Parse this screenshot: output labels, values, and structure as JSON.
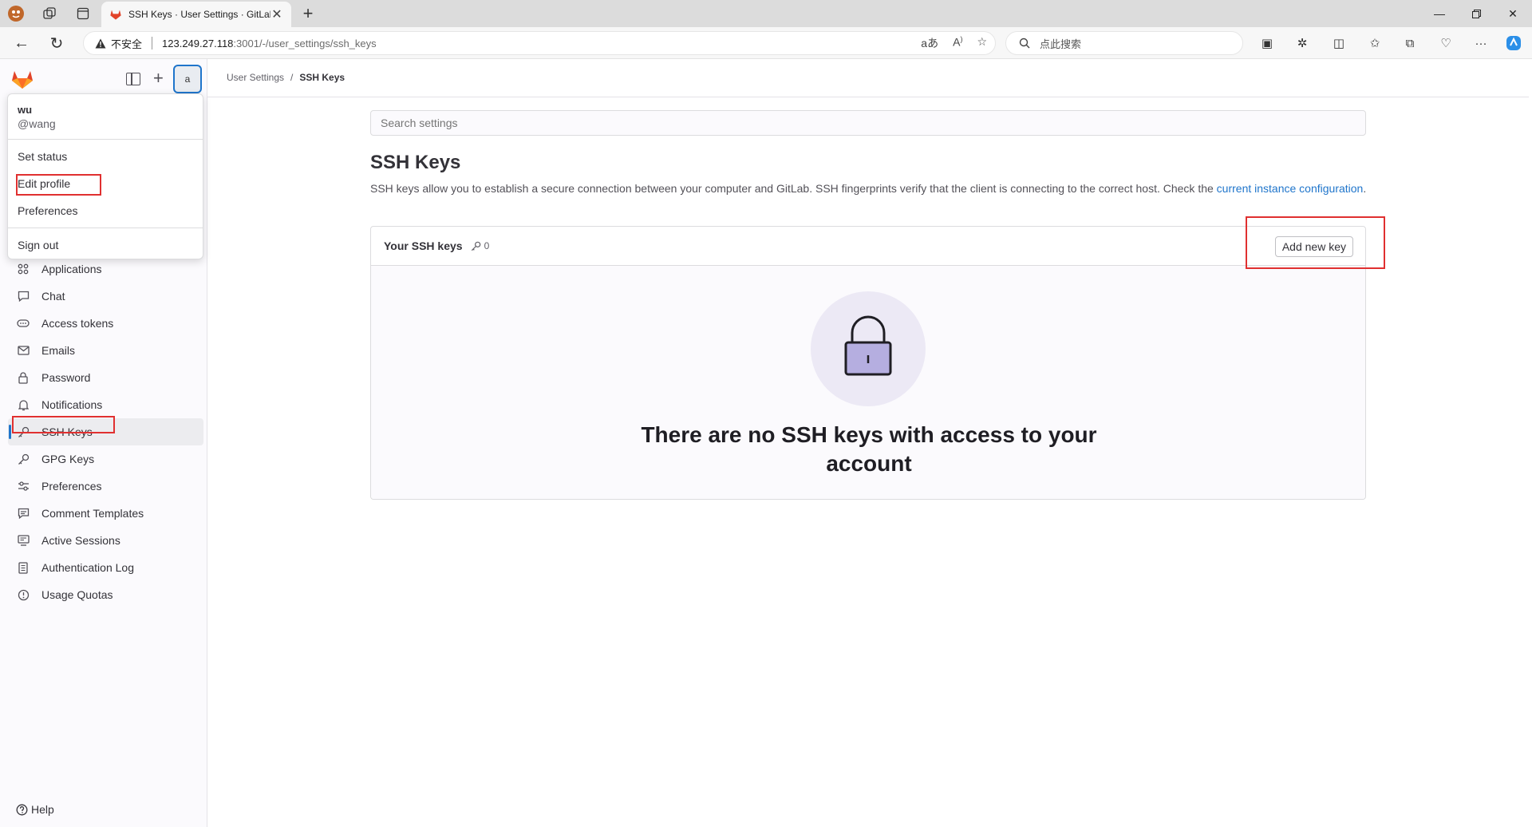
{
  "browser": {
    "tab_title": "SSH Keys · User Settings · GitLab",
    "url_warning": "不安全",
    "url_host": "123.249.27.118",
    "url_path": ":3001/-/user_settings/ssh_keys",
    "search_placeholder": "点此搜索",
    "read_aloud_label": "aあ"
  },
  "user_menu": {
    "name": "wu",
    "handle": "@wang",
    "items": [
      "Set status",
      "Edit profile",
      "Preferences"
    ],
    "sign_out": "Sign out",
    "avatar_alt": "a"
  },
  "sidebar": {
    "items": [
      {
        "label": "Applications",
        "icon": "applications-icon"
      },
      {
        "label": "Chat",
        "icon": "comment-icon"
      },
      {
        "label": "Access tokens",
        "icon": "token-icon"
      },
      {
        "label": "Emails",
        "icon": "mail-icon"
      },
      {
        "label": "Password",
        "icon": "lock-icon"
      },
      {
        "label": "Notifications",
        "icon": "bell-icon"
      },
      {
        "label": "SSH Keys",
        "icon": "key-icon"
      },
      {
        "label": "GPG Keys",
        "icon": "key-icon"
      },
      {
        "label": "Preferences",
        "icon": "preferences-icon"
      },
      {
        "label": "Comment Templates",
        "icon": "comment-template-icon"
      },
      {
        "label": "Active Sessions",
        "icon": "monitor-icon"
      },
      {
        "label": "Authentication Log",
        "icon": "log-icon"
      },
      {
        "label": "Usage Quotas",
        "icon": "quota-icon"
      }
    ],
    "active_index": 6,
    "help": "Help"
  },
  "breadcrumb": {
    "parent": "User Settings",
    "separator": "/",
    "current": "SSH Keys"
  },
  "settings_search": {
    "placeholder": "Search settings"
  },
  "page": {
    "title": "SSH Keys",
    "description": "SSH keys allow you to establish a secure connection between your computer and GitLab. SSH fingerprints verify that the client is connecting to the correct host. Check the ",
    "description_link": "current instance configuration",
    "description_end": "."
  },
  "ssh_card": {
    "title": "Your SSH keys",
    "count": "0",
    "add_button": "Add new key",
    "empty_text": "There are no SSH keys with access to your account"
  },
  "colors": {
    "accent": "#1f75cb",
    "highlight": "#e03030",
    "gitlab_orange": "#e24329"
  }
}
